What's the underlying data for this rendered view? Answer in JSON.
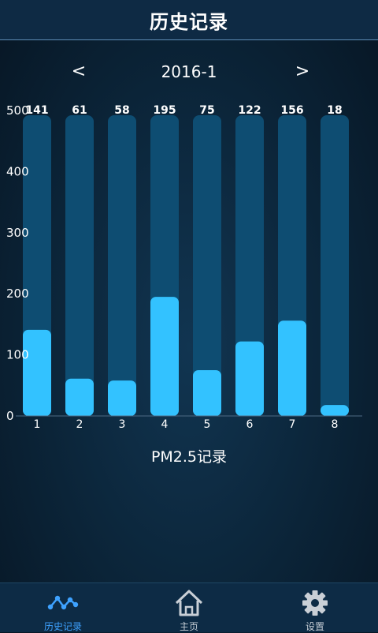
{
  "header": {
    "title": "历史记录"
  },
  "month_nav": {
    "prev_label": "<",
    "month": "2016-1",
    "next_label": ">"
  },
  "chart_data": {
    "type": "bar",
    "categories": [
      "1",
      "2",
      "3",
      "4",
      "5",
      "6",
      "7",
      "8"
    ],
    "values": [
      141,
      61,
      58,
      195,
      75,
      122,
      156,
      18
    ],
    "ylim": [
      0,
      500
    ],
    "yticks": [
      0,
      100,
      200,
      300,
      400,
      500
    ],
    "xlabel": "PM2.5记录",
    "colors": {
      "bar": "#33c2ff",
      "track": "#0e4d72"
    }
  },
  "tabbar": {
    "items": [
      {
        "label": "历史记录",
        "icon": "line-chart-icon",
        "active": true
      },
      {
        "label": "主页",
        "icon": "home-icon",
        "active": false
      },
      {
        "label": "设置",
        "icon": "gear-icon",
        "active": false
      }
    ],
    "active_color": "#3ea2ff"
  }
}
